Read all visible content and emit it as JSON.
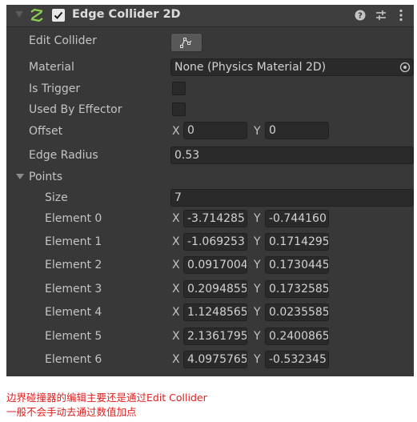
{
  "component": {
    "title": "Edge Collider 2D",
    "enabled": true
  },
  "properties": {
    "edit_collider_label": "Edit Collider",
    "material_label": "Material",
    "material_value": "None (Physics Material 2D)",
    "is_trigger_label": "Is Trigger",
    "used_by_effector_label": "Used By Effector",
    "offset_label": "Offset",
    "offset": {
      "x": "0",
      "y": "0"
    },
    "edge_radius_label": "Edge Radius",
    "edge_radius_value": "0.53"
  },
  "points": {
    "label": "Points",
    "size_label": "Size",
    "size_value": "7",
    "axis_x": "X",
    "axis_y": "Y",
    "elements": [
      {
        "label": "Element 0",
        "x": "-3.714285",
        "y": "-0.744160"
      },
      {
        "label": "Element 1",
        "x": "-1.069253",
        "y": "0.1714295"
      },
      {
        "label": "Element 2",
        "x": "0.0917004",
        "y": "0.1730445"
      },
      {
        "label": "Element 3",
        "x": "0.2094855",
        "y": "0.1732585"
      },
      {
        "label": "Element 4",
        "x": "1.1248565",
        "y": "0.0235585"
      },
      {
        "label": "Element 5",
        "x": "2.1361795",
        "y": "0.2400865"
      },
      {
        "label": "Element 6",
        "x": "4.0975765",
        "y": "-0.532345"
      }
    ]
  },
  "notes": {
    "line1": "边界碰撞器的编辑主要还是通过Edit Collider",
    "line2": "一般不会手动去通过数值加点"
  },
  "icons": {
    "component": "edge-collider-icon",
    "help": "help-icon",
    "presets": "presets-icon",
    "menu": "kebab-menu-icon",
    "edit": "edit-collider-icon",
    "object_picker": "object-picker-icon"
  },
  "colors": {
    "panel": "#383838",
    "field": "#2a2a2a",
    "accent": "#8fd14f",
    "note": "#e02020"
  }
}
